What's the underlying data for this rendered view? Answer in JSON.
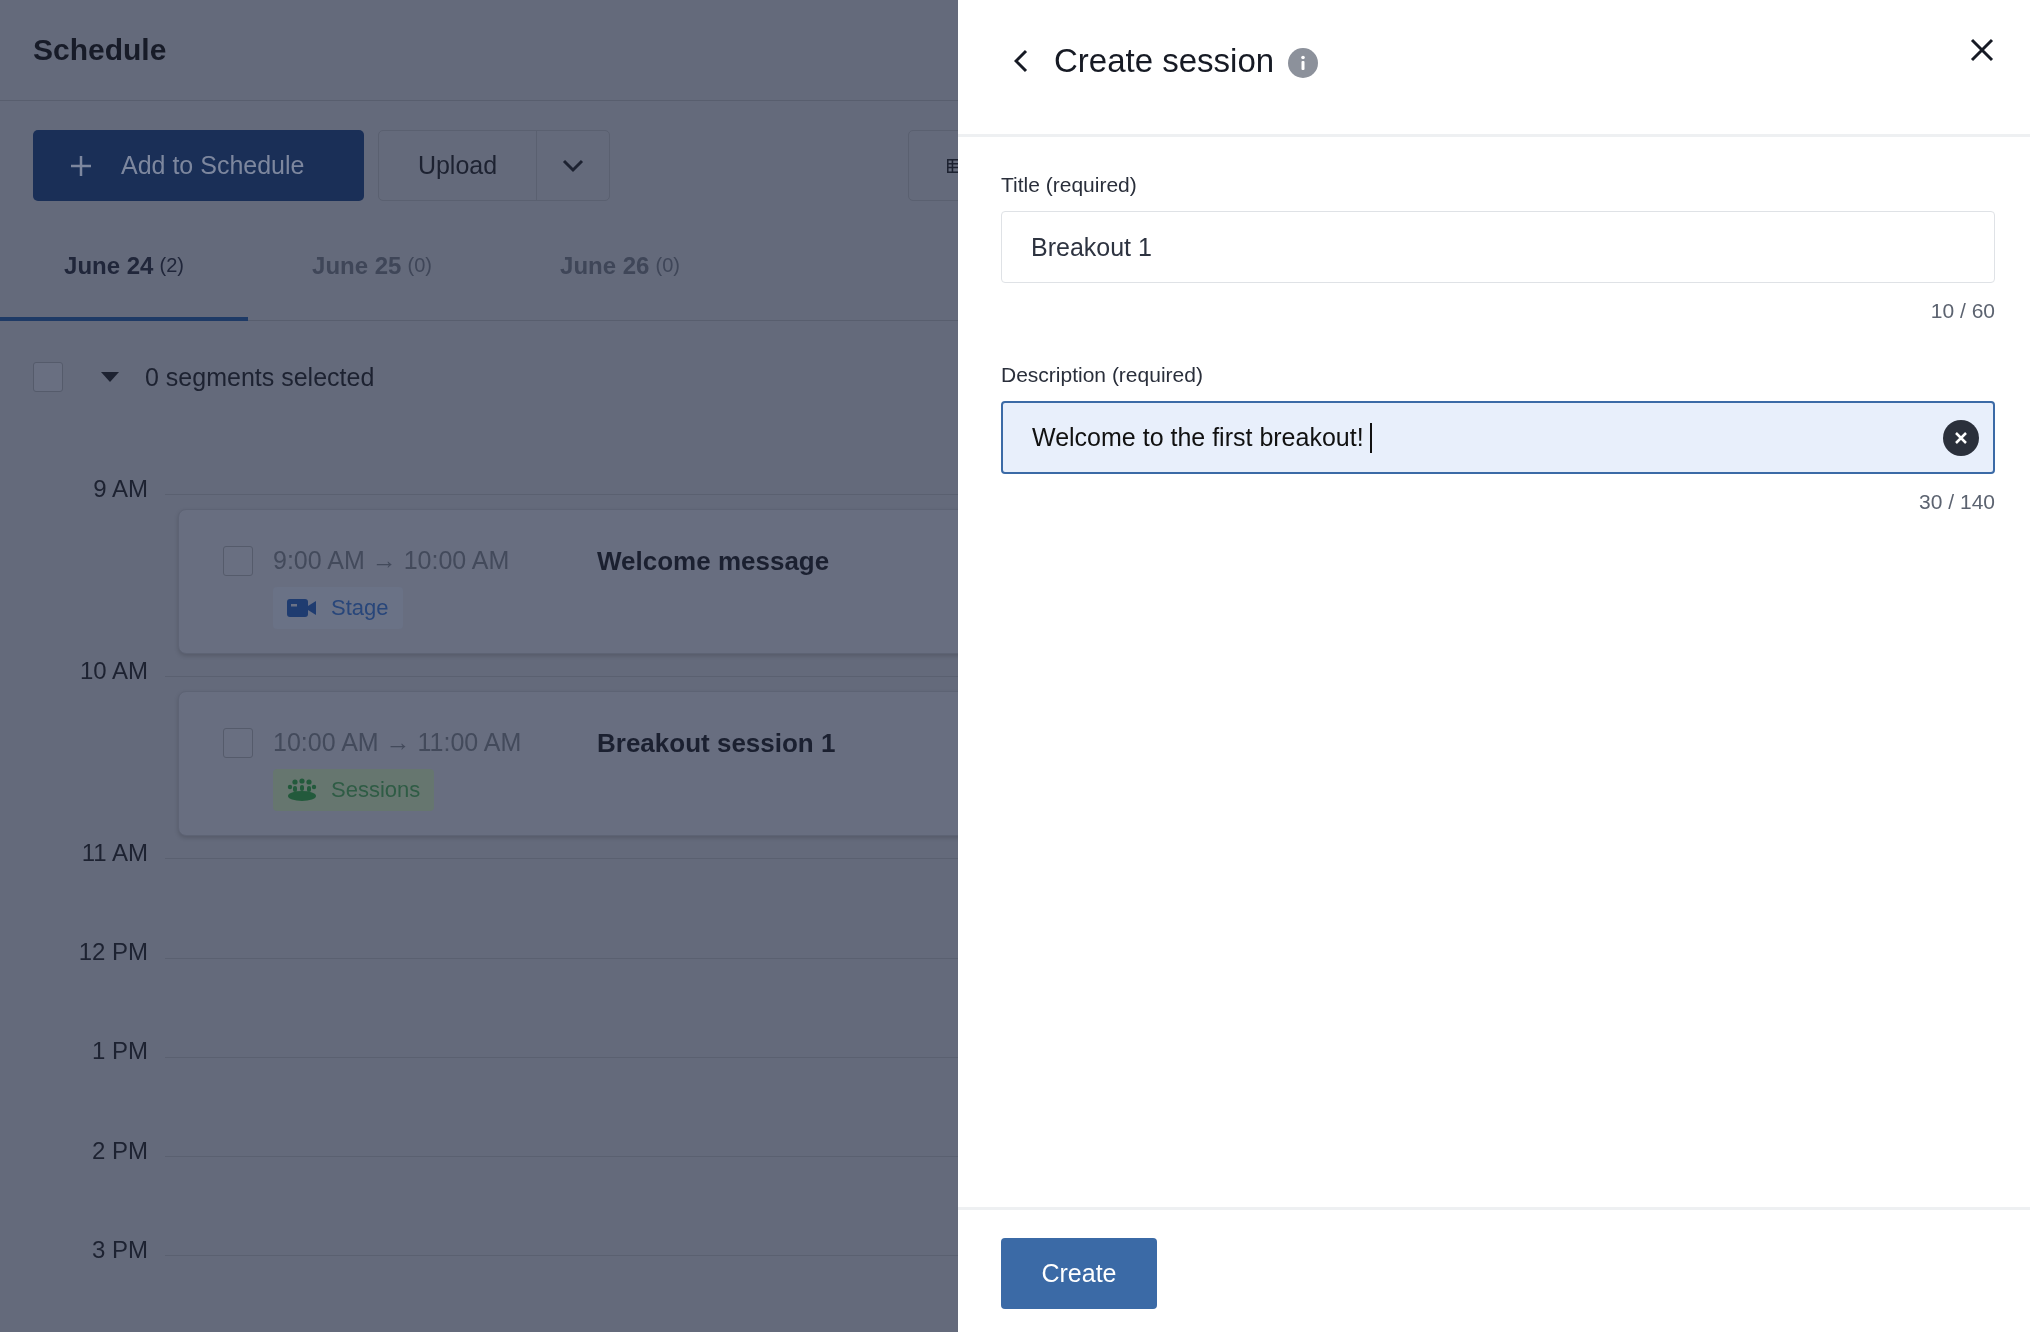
{
  "page": {
    "title": "Schedule"
  },
  "toolbar": {
    "add_button": "Add to Schedule",
    "upload_button": "Upload"
  },
  "tabs": [
    {
      "label": "June 24",
      "count": "(2)",
      "selected": true
    },
    {
      "label": "June 25",
      "count": "(0)",
      "selected": false
    },
    {
      "label": "June 26",
      "count": "(0)",
      "selected": false
    }
  ],
  "selection": {
    "checked": false,
    "label": "0 segments selected"
  },
  "timeline": [
    {
      "label": "9 AM",
      "events": [
        {
          "checked": false,
          "start": "9:00 AM",
          "arrow": "→",
          "end": "10:00 AM",
          "title": "Welcome message",
          "kind": "stage",
          "tag": "Stage"
        }
      ]
    },
    {
      "label": "10 AM",
      "events": [
        {
          "checked": false,
          "start": "10:00 AM",
          "arrow": "→",
          "end": "11:00 AM",
          "title": "Breakout session 1",
          "kind": "sessions",
          "tag": "Sessions"
        }
      ]
    },
    {
      "label": "11 AM"
    },
    {
      "label": "12 PM"
    },
    {
      "label": "1 PM"
    },
    {
      "label": "2 PM"
    },
    {
      "label": "3 PM"
    }
  ],
  "panel": {
    "title": "Create session",
    "fields": [
      {
        "label": "Title (required)",
        "value": "Breakout 1",
        "counter": "10 / 60",
        "focused": false
      },
      {
        "label": "Description (required)",
        "value": "Welcome to the first breakout!",
        "counter": "30 / 140",
        "focused": true
      }
    ],
    "submit_button": "Create"
  }
}
